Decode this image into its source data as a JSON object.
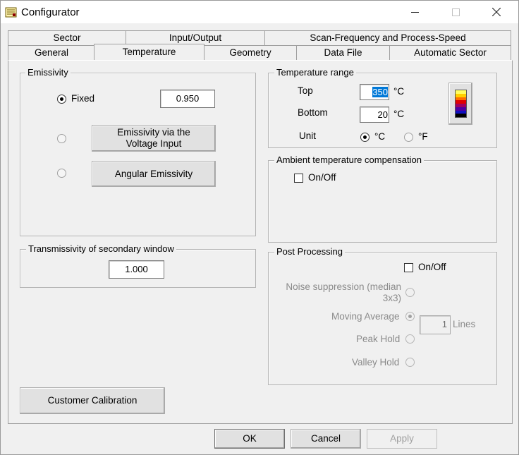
{
  "window": {
    "title": "Configurator",
    "minimize": "minimize",
    "maximize": "maximize",
    "close": "close"
  },
  "tabs": {
    "row_back": [
      "Sector",
      "Input/Output",
      "Scan-Frequency and Process-Speed"
    ],
    "row_front": [
      "General",
      "Temperature",
      "Geometry",
      "Data File",
      "Automatic Sector"
    ],
    "active": "Temperature"
  },
  "emissivity": {
    "label": "Emissivity",
    "fixed_label": "Fixed",
    "fixed_value": "0.950",
    "voltage_button": "Emissivity via the Voltage Input",
    "angular_button": "Angular Emissivity",
    "selected": "Fixed"
  },
  "transmissivity": {
    "label": "Transmissivity of secondary window",
    "value": "1.000"
  },
  "temperature_range": {
    "label": "Temperature range",
    "top_label": "Top",
    "top_value": "350",
    "top_unit": "°C",
    "bottom_label": "Bottom",
    "bottom_value": "20",
    "bottom_unit": "°C",
    "unit_label": "Unit",
    "unit_c": "°C",
    "unit_f": "°F",
    "unit_selected": "°C",
    "palette_colors": [
      "#ffff60",
      "#ffd000",
      "#ff7000",
      "#e00000",
      "#a00060",
      "#5000a0",
      "#1010c0",
      "#000000"
    ]
  },
  "ambient": {
    "label": "Ambient temperature compensation",
    "onoff_label": "On/Off",
    "checked": false
  },
  "post_processing": {
    "label": "Post Processing",
    "onoff_label": "On/Off",
    "checked": false,
    "noise_label": "Noise suppression (median 3x3)",
    "moving_label": "Moving Average",
    "moving_value": "1",
    "moving_unit": "Lines",
    "peak_label": "Peak Hold",
    "valley_label": "Valley Hold",
    "selected": "Moving Average"
  },
  "calibration_button": "Customer Calibration",
  "dialog": {
    "ok": "OK",
    "cancel": "Cancel",
    "apply": "Apply"
  }
}
